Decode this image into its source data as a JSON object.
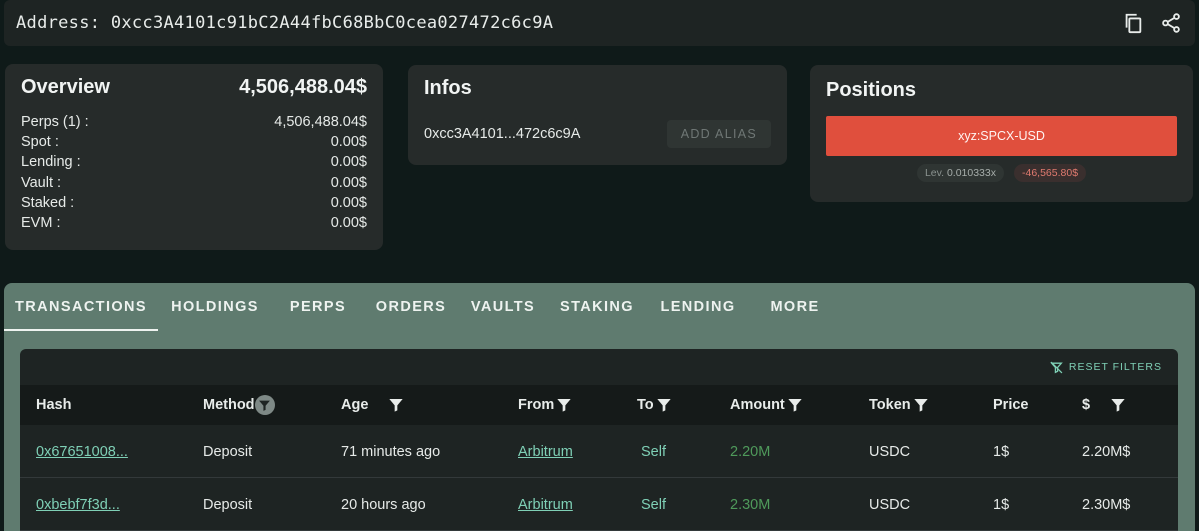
{
  "address_bar": {
    "label": "Address: 0xcc3A4101c91bC2A44fbC68BbC0cea027472c6c9A",
    "copy_icon": "copy-icon",
    "share_icon": "share-icon"
  },
  "overview": {
    "title": "Overview",
    "total": "4,506,488.04$",
    "rows": [
      {
        "label": "Perps (1) :",
        "value": "4,506,488.04$"
      },
      {
        "label": "Spot :",
        "value": "0.00$"
      },
      {
        "label": "Lending :",
        "value": "0.00$"
      },
      {
        "label": "Vault :",
        "value": "0.00$"
      },
      {
        "label": "Staked :",
        "value": "0.00$"
      },
      {
        "label": "EVM :",
        "value": "0.00$"
      }
    ]
  },
  "infos": {
    "title": "Infos",
    "short_address": "0xcc3A4101...472c6c9A",
    "add_alias_label": "ADD ALIAS"
  },
  "positions": {
    "title": "Positions",
    "items": [
      {
        "label": "xyz:SPCX-USD",
        "lev_label": "Lev.",
        "lev_value": "0.010333x",
        "pnl": "-46,565.80$",
        "color": "#e04f3d"
      }
    ]
  },
  "tabs": [
    {
      "label": "TRANSACTIONS",
      "active": true
    },
    {
      "label": "HOLDINGS"
    },
    {
      "label": "PERPS"
    },
    {
      "label": "ORDERS"
    },
    {
      "label": "VAULTS"
    },
    {
      "label": "STAKING"
    },
    {
      "label": "LENDING"
    },
    {
      "label": "MORE"
    }
  ],
  "table": {
    "reset_filters_label": "RESET FILTERS",
    "columns": [
      "Hash",
      "Method",
      "Age",
      "From",
      "To",
      "Amount",
      "Token",
      "Price",
      "$"
    ],
    "rows": [
      {
        "hash": "0x67651008...",
        "method": "Deposit",
        "age": "71 minutes ago",
        "from": "Arbitrum",
        "to": "Self",
        "amount": "2.20M",
        "token": "USDC",
        "price": "1$",
        "usd": "2.20M$"
      },
      {
        "hash": "0xbebf7f3d...",
        "method": "Deposit",
        "age": "20 hours ago",
        "from": "Arbitrum",
        "to": "Self",
        "amount": "2.30M",
        "token": "USDC",
        "price": "1$",
        "usd": "2.30M$"
      }
    ]
  },
  "colors": {
    "accent": "#7fd0b6",
    "negative": "#e04f3d",
    "amount_green": "#4f9a5b",
    "tab_bar": "#5f7b6f",
    "card": "#262b2a"
  }
}
